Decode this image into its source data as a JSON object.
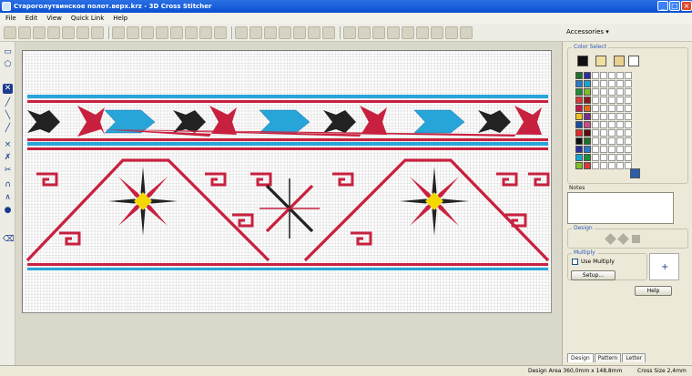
{
  "window": {
    "title": "Староголутвинское полот.верх.krz - 3D Cross Stitcher"
  },
  "menu": [
    "File",
    "Edit",
    "View",
    "Quick Link",
    "Help"
  ],
  "toolbar": {
    "accessories": "Accessories ▾"
  },
  "panel": {
    "color_select": "Color Select",
    "notes": "Notes",
    "design": "Design",
    "multiply": "Multiply",
    "use_multiply": "Use Multiply",
    "setup": "Setup...",
    "help": "Help",
    "tabs": [
      "Design",
      "Pattern",
      "Letter"
    ],
    "palette": [
      "#1f6f2b",
      "#2c2f9a",
      "#2a78c8",
      "#15a7d4",
      "#1e8c3a",
      "#7fbf2a",
      "#d63a3a",
      "#8b1a1a",
      "#c0184a",
      "#e06a1a",
      "#f0c020",
      "#7a2a8a",
      "#1b4aa0",
      "#c74a8a",
      "#e02a2a",
      "#5a0a0a",
      "#101010"
    ]
  },
  "colors": {
    "red": "#c8213f",
    "black": "#222222",
    "blue": "#28a5d8",
    "yellow": "#f5d800",
    "grid": "#bdbdbd"
  },
  "status": {
    "design_area": "Design Area  360,0mm x 148,8mm",
    "cross_size": "Cross Size  2,4mm"
  }
}
